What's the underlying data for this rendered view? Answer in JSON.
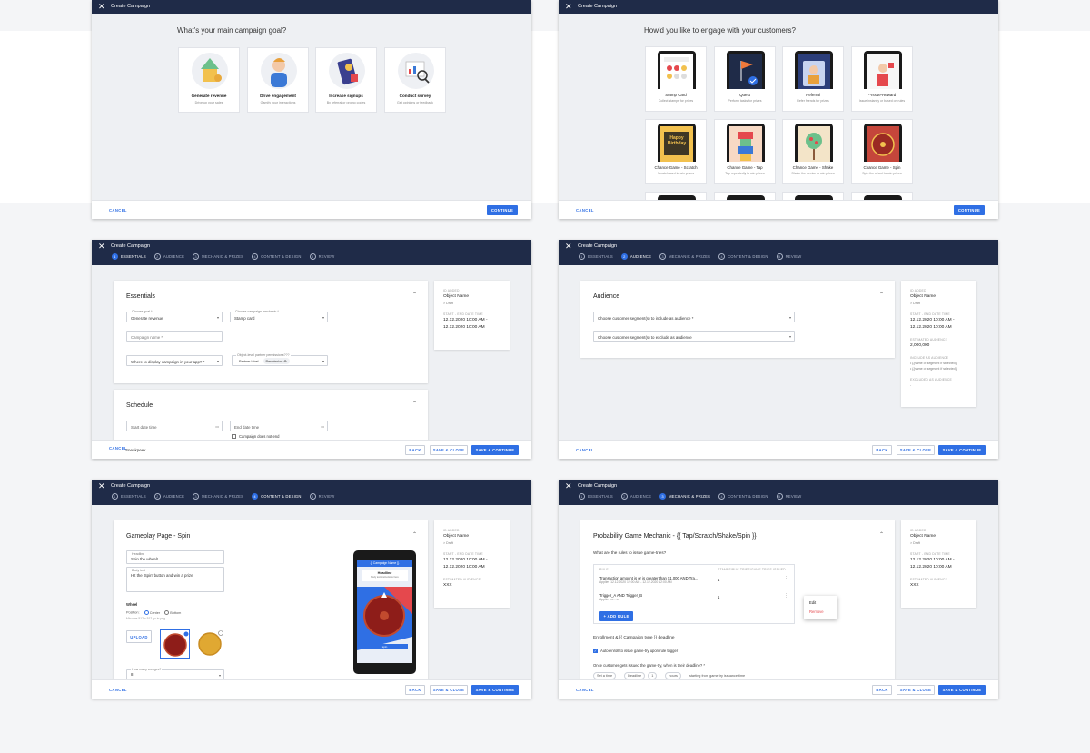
{
  "header": {
    "title": "Create Campaign"
  },
  "steps": [
    {
      "num": "1",
      "label": "ESSENTIALS"
    },
    {
      "num": "2",
      "label": "AUDIENCE"
    },
    {
      "num": "3",
      "label": "MECHANIC & PRIZES"
    },
    {
      "num": "4",
      "label": "CONTENT & DESIGN"
    },
    {
      "num": "5",
      "label": "REVIEW"
    }
  ],
  "footer": {
    "cancel": "CANCEL",
    "continue": "CONTINUE",
    "back": "BACK",
    "save_close": "SAVE & CLOSE",
    "save_continue": "SAVE & CONTINUE",
    "sneakpeek": "Sneakpeek"
  },
  "goal": {
    "question": "What's your main campaign goal?",
    "options": [
      {
        "title": "Generate revenue",
        "sub": "Drive up your sales"
      },
      {
        "title": "Drive engagement",
        "sub": "Gamify your interactions"
      },
      {
        "title": "Increase signups",
        "sub": "By referral or promo codes"
      },
      {
        "title": "Conduct survey",
        "sub": "Get opinions or feedback"
      }
    ]
  },
  "engage": {
    "question": "How'd you like to engage with your customers?",
    "options": [
      {
        "title": "Stamp Card",
        "sub": "Collect stamps for prizes"
      },
      {
        "title": "Quest",
        "sub": "Perform tasks for prizes"
      },
      {
        "title": "Referral",
        "sub": "Refer friends for prizes"
      },
      {
        "title": "**Issue-Reward",
        "sub": "Issue instantly or based on rules"
      },
      {
        "title": "Chance Game - Scratch",
        "sub": "Scratch card to win prizes"
      },
      {
        "title": "Chance Game - Tap",
        "sub": "Tap repeatedly to win prizes"
      },
      {
        "title": "Chance Game - Shake",
        "sub": "Shake the device to win prizes"
      },
      {
        "title": "Chance Game - Spin",
        "sub": "Spin the wheel to win prizes"
      }
    ],
    "birthday_text": "Happy Birthday"
  },
  "essentials": {
    "title": "Essentials",
    "goal_label": "Choose goal *",
    "goal_value": "Generate revenue",
    "mechanic_label": "Choose campaign mechanic *",
    "mechanic_value": "Stamp card",
    "name_placeholder": "Campaign name *",
    "display_placeholder": "Where to display campaign in your app? *",
    "permission_label": "Object-level partner permissions???",
    "chip_partner": "Partner label",
    "chip_permission": "Permission",
    "schedule_title": "Schedule",
    "start_placeholder": "Start date time",
    "end_placeholder": "End date time",
    "no_end": "Campaign does not end"
  },
  "summary": {
    "id_label": "ID ADDED",
    "object_name": "Object Name",
    "draft": "> Draft",
    "dates_label": "START - END DATE TIME",
    "dates_value_1": "12.12.2020 10:00 AM -",
    "dates_value_2": "12.12.2020 10:00 AM",
    "est_label": "ESTIMATED AUDIENCE",
    "est_value": "2,000,000",
    "est_xxx": "XXX",
    "include_label": "INCLUDE AS AUDIENCE",
    "include_1": "• {{name of segment if selected}}",
    "include_2": "• {{name of segment if selected}}",
    "exclude_label": "EXCLUDED AS AUDIENCE",
    "exclude_value": "-"
  },
  "audience": {
    "title": "Audience",
    "include_placeholder": "Choose customer segment(s) to include as audience *",
    "exclude_placeholder": "Choose customer segment(s) to exclude as audience"
  },
  "gameplay": {
    "title": "Gameplay Page - Spin",
    "headline_label": "Headline",
    "headline_value": "Spin the wheel!",
    "body_label": "Body text",
    "body_value": "Hit the 'Spin' button and win a prize",
    "wheel_label": "Wheel",
    "position_label": "Position:",
    "pos_center": "Center",
    "pos_bottom": "Bottom",
    "size_hint": "Min size 512 x 512 px in png",
    "upload": "UPLOAD",
    "wedges_label": "How many wedges?",
    "wedges_value": "8",
    "preview_title": "{{ Campaign Name }}",
    "preview_headline": "Headline",
    "preview_body": "Body text instructions here",
    "preview_btn": "spin"
  },
  "probability": {
    "title": "Probability Game Mechanic - {{ Tap/Scratch/Shake/Spin }}",
    "question": "What are the rules to issue game-tries?",
    "col_rule": "RULE",
    "col_stamps": "STAMPS/BUC TRIES/GAME TRIES ISSUED",
    "rules": [
      {
        "name": "Transaction amount is or is greater than $1,000 AND Tra...",
        "sub": "Applies 12.12.2020 12:00 AM - 12.12.2020 12:00 AM",
        "count": "1"
      },
      {
        "name": "Trigger_A AND Trigger_B",
        "sub": "Applies xx - xx",
        "count": "1"
      }
    ],
    "add_rule": "+ ADD RULE",
    "menu_edit": "Edit",
    "menu_remove": "Remove",
    "enroll_title": "Enrollment & {{ Campaign type }} deadline",
    "auto_enroll": "Auto-enroll to issue game-try upon rule trigger",
    "deadline_q": "Once customer gets issued the game-try, when is their deadline? *",
    "f1": "Set a time",
    "f2": "Deadline",
    "f3": "1",
    "f4": "hours",
    "f5": "starting from game try issuance time"
  },
  "colors": {
    "navy": "#1f2b48",
    "blue": "#2f6fe4",
    "red": "#e5484d"
  }
}
